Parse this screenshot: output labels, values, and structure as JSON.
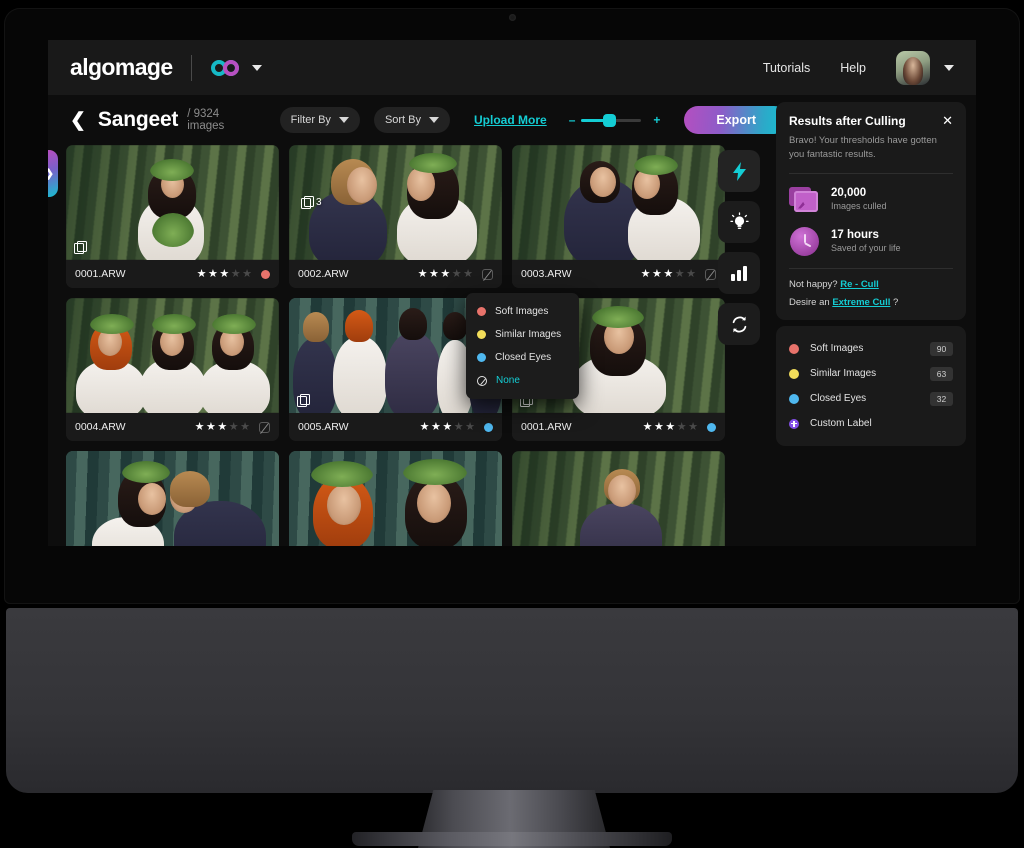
{
  "app": {
    "logo_text": "algomage",
    "brand_mark_icon": "infinity-loop-icon",
    "brand_caret_icon": "chevron-down-icon"
  },
  "topnav": {
    "links": [
      {
        "label": "Tutorials",
        "name": "tutorials-link"
      },
      {
        "label": "Help",
        "name": "help-link"
      }
    ],
    "avatar_alt": "user-avatar",
    "account_caret_icon": "chevron-down-icon"
  },
  "toolbar": {
    "back_icon": "chevron-left-icon",
    "album_title": "Sangeet",
    "album_count": "/ 9324 images",
    "filter_by": "Filter By",
    "sort_by": "Sort By",
    "upload_more": "Upload More",
    "zoom_minus": "–",
    "zoom_plus": "+",
    "zoom_value": "40",
    "export_label": "Export"
  },
  "side_tab": {
    "icon": "chevron-right-icon"
  },
  "tool_rail": [
    {
      "name": "quick-cull-button",
      "icon": "lightning-bolt-icon",
      "active": true
    },
    {
      "name": "insights-button",
      "icon": "lightbulb-icon",
      "active": false
    },
    {
      "name": "statistics-button",
      "icon": "bar-chart-icon",
      "active": false
    },
    {
      "name": "refresh-button",
      "icon": "refresh-sync-icon",
      "active": false
    }
  ],
  "grid": {
    "cards": [
      {
        "file": "0001.ARW",
        "rating": 3,
        "max_rating": 5,
        "label": "soft",
        "label_color": "#e8736b",
        "stack_count": "",
        "scene": "bride-bouquet-forest"
      },
      {
        "file": "0002.ARW",
        "rating": 3,
        "max_rating": 5,
        "label": "none",
        "label_color": "",
        "stack_count": "3",
        "scene": "couple-foreheads-touching"
      },
      {
        "file": "0003.ARW",
        "rating": 3,
        "max_rating": 5,
        "label": "none",
        "label_color": "",
        "stack_count": "",
        "scene": "couple-embrace-forest"
      },
      {
        "file": "0004.ARW",
        "rating": 3,
        "max_rating": 5,
        "label": "none",
        "label_color": "",
        "stack_count": "",
        "scene": "three-bridesmaids-wreaths"
      },
      {
        "file": "0005.ARW",
        "rating": 3,
        "max_rating": 5,
        "label": "closed-eyes",
        "label_color": "#4fb8ef",
        "stack_count": "",
        "scene": "wedding-party-group"
      },
      {
        "file": "0001.ARW",
        "rating": 3,
        "max_rating": 5,
        "label": "closed-eyes",
        "label_color": "#4fb8ef",
        "stack_count": "",
        "scene": "bride-portrait-forest"
      },
      {
        "file": "",
        "rating": 0,
        "max_rating": 5,
        "label": "",
        "label_color": "",
        "stack_count": "",
        "scene": "couple-eating-burger"
      },
      {
        "file": "",
        "rating": 0,
        "max_rating": 5,
        "label": "",
        "label_color": "",
        "stack_count": "",
        "scene": "two-women-eating"
      },
      {
        "file": "",
        "rating": 0,
        "max_rating": 5,
        "label": "",
        "label_color": "",
        "stack_count": "",
        "scene": "groom-portrait-forest"
      }
    ]
  },
  "label_menu": {
    "items": [
      {
        "label": "Soft Images",
        "color": "#e8736b",
        "selected": false
      },
      {
        "label": "Similar Images",
        "color": "#f2dd5a",
        "selected": false
      },
      {
        "label": "Closed Eyes",
        "color": "#4fb8ef",
        "selected": false
      },
      {
        "label": "None",
        "color": "",
        "selected": true
      }
    ]
  },
  "results_panel": {
    "title": "Results after Culling",
    "close_icon": "close-icon",
    "subtitle": "Bravo! Your thresholds have gotten you fantastic results.",
    "stats": [
      {
        "value": "20,000",
        "label": "Images culled",
        "icon": "photo-stack-icon"
      },
      {
        "value": "17 hours",
        "label": "Saved of your life",
        "icon": "clock-icon"
      }
    ],
    "recull_prefix": "Not happy?",
    "recull_link": "Re - Cull",
    "extreme_prefix": "Desire an",
    "extreme_link": "Extreme Cull",
    "extreme_suffix": "?"
  },
  "labels_panel": {
    "rows": [
      {
        "label": "Soft Images",
        "count": "90",
        "color": "#e8736b",
        "type": "dot"
      },
      {
        "label": "Similar Images",
        "count": "63",
        "color": "#f2dd5a",
        "type": "dot"
      },
      {
        "label": "Closed Eyes",
        "count": "32",
        "color": "#4fb8ef",
        "type": "dot"
      },
      {
        "label": "Custom Label",
        "count": "",
        "color": "#8350e8",
        "type": "plus"
      }
    ]
  },
  "colors": {
    "accent_teal": "#14cdd4",
    "gradient_start": "#b44fc0",
    "gradient_end": "#12c4d2",
    "panel_bg": "#1a1a1a",
    "screen_bg": "#0d0d0d"
  }
}
